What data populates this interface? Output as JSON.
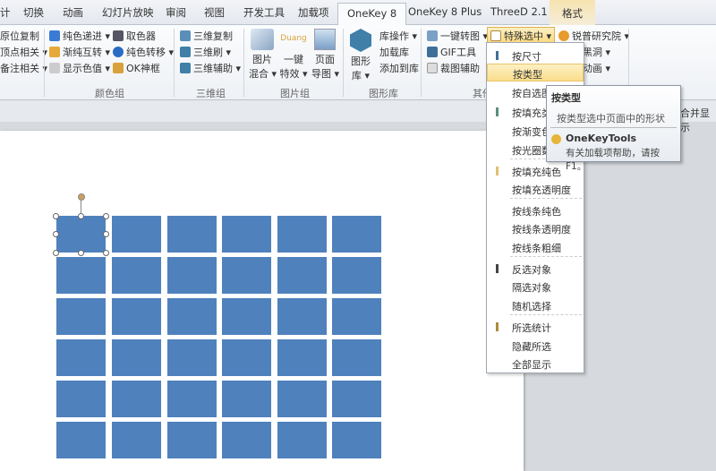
{
  "tabs": [
    "计",
    "切换",
    "动画",
    "幻灯片放映",
    "审阅",
    "视图",
    "开发工具",
    "加载项",
    "OneKey 8",
    "OneKey 8 Plus",
    "ThreeD 2.1",
    "格式"
  ],
  "ribbon": {
    "col0": [
      "原位复制",
      "顶点相关 ▾",
      "备注相关 ▾"
    ],
    "color_group": {
      "items": [
        "纯色递进 ▾",
        "渐纯互转 ▾",
        "显示色值 ▾",
        "取色器",
        "纯色转移 ▾",
        "OK神框"
      ],
      "label": "颜色组"
    },
    "threed_group": {
      "items": [
        "三维复制",
        "三维刷 ▾",
        "三维辅助 ▾"
      ],
      "label": "三维组"
    },
    "picture_group": {
      "items": [
        "图片\n混合 ▾",
        "一键\n特效 ▾",
        "页面\n导图 ▾"
      ],
      "l1": [
        "图片",
        "一键",
        "页面"
      ],
      "l2": [
        "混合 ▾",
        "特效 ▾",
        "导图 ▾"
      ],
      "duang": "Duang",
      "label": "图片组"
    },
    "shape_lib": {
      "big": [
        "图形",
        "库 ▾"
      ],
      "items": [
        "库操作 ▾",
        "加载库",
        "添加到库"
      ],
      "label": "图形库"
    },
    "other": {
      "items": [
        "一键转图 ▾",
        "GIF工具",
        "裁图辅助",
        "特殊选中 ▾"
      ],
      "label": "其他"
    },
    "rp": {
      "items": [
        "锐普研究院 ▾",
        "吉黑洞 ▾",
        "类动画 ▾"
      ]
    },
    "right_text": "合并显示"
  },
  "menu": {
    "items": [
      "按尺寸",
      "按类型",
      "按自选图",
      "按填充类",
      "按渐变色",
      "按光圈数",
      "按填充纯色",
      "按填充透明度",
      "按线条纯色",
      "按线条透明度",
      "按线条粗细",
      "反选对象",
      "隔选对象",
      "随机选择",
      "所选统计",
      "隐藏所选",
      "全部显示"
    ],
    "hover_index": 1
  },
  "tooltip": {
    "title": "按类型",
    "desc": "按类型选中页面中的形状",
    "addin": "OneKeyTools",
    "help": "有关加载项帮助，请按 F1。"
  },
  "colors": {
    "shape": "#4f81bd",
    "accent": "#f9de8a"
  }
}
